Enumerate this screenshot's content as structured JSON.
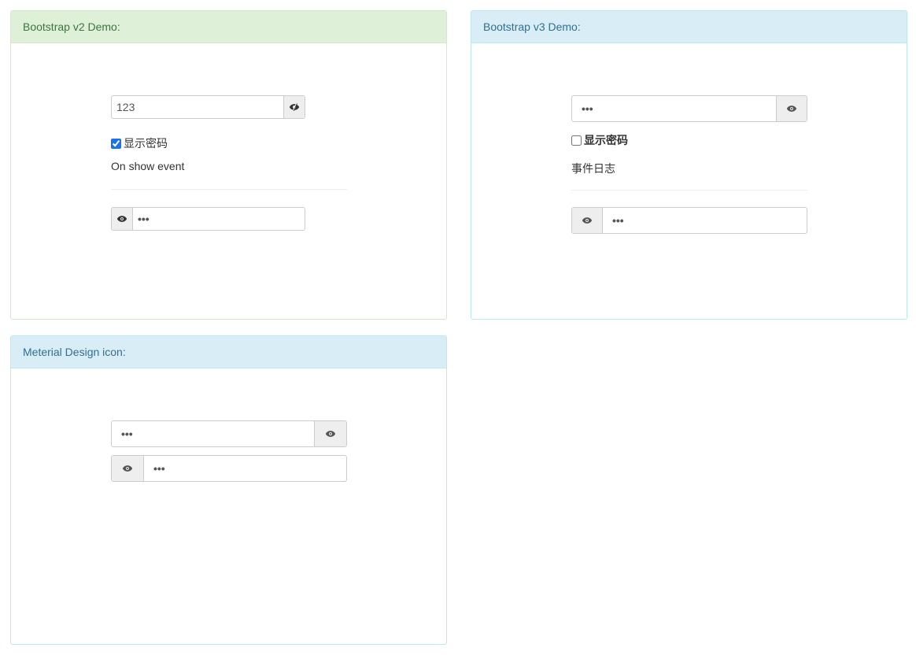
{
  "panels": {
    "v2": {
      "title": "Bootstrap v2 Demo:",
      "password_value": "123",
      "show_password_label": "显示密码",
      "show_password_checked": true,
      "event_text": "On show event",
      "second_value": "•••"
    },
    "v3": {
      "title": "Bootstrap v3 Demo:",
      "password_value": "•••",
      "show_password_label": "显示密码",
      "show_password_checked": false,
      "event_text": "事件日志",
      "second_value": "•••"
    },
    "md": {
      "title": "Meterial Design icon:",
      "first_value": "•••",
      "second_value": "•••"
    }
  },
  "icons": {
    "eye": "eye-icon",
    "eye_slash": "eye-slash-icon"
  },
  "colors": {
    "success_bg": "#dff0d8",
    "success_text": "#3c763d",
    "info_bg": "#d9edf7",
    "info_text": "#31708f",
    "addon_bg": "#eeeeee"
  }
}
